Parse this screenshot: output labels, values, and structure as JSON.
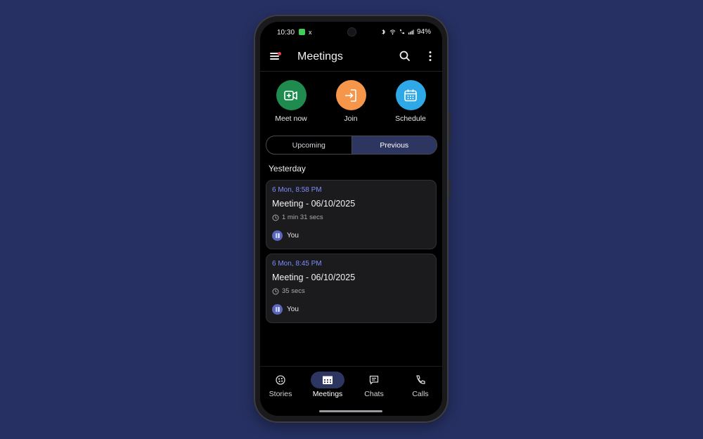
{
  "status_bar": {
    "time": "10:30",
    "x_icon": "x",
    "battery": "94%",
    "icons": [
      "bluetooth-icon",
      "wifi-icon",
      "call-icon",
      "signal-icon"
    ]
  },
  "app_bar": {
    "title": "Meetings",
    "icons": [
      "menu-icon",
      "search-icon",
      "more-vertical-icon"
    ]
  },
  "quick_actions": [
    {
      "label": "Meet now",
      "icon": "video-plus-icon",
      "color": "#1f8b4e"
    },
    {
      "label": "Join",
      "icon": "join-icon",
      "color": "#f5964a"
    },
    {
      "label": "Schedule",
      "icon": "calendar-icon",
      "color": "#2ea8e6"
    }
  ],
  "tabs": [
    {
      "label": "Upcoming",
      "active": false
    },
    {
      "label": "Previous",
      "active": true
    }
  ],
  "section_label": "Yesterday",
  "meetings": [
    {
      "when": "6 Mon, 8:58 PM",
      "title": "Meeting - 06/10/2025",
      "duration": "1 min 31 secs",
      "attendee": "You"
    },
    {
      "when": "6 Mon, 8:45 PM",
      "title": "Meeting - 06/10/2025",
      "duration": "35 secs",
      "attendee": "You"
    }
  ],
  "bottom_nav": [
    {
      "label": "Stories",
      "icon": "stories-icon",
      "active": false
    },
    {
      "label": "Meetings",
      "icon": "meetings-icon",
      "active": true
    },
    {
      "label": "Chats",
      "icon": "chat-icon",
      "active": false
    },
    {
      "label": "Calls",
      "icon": "phone-icon",
      "active": false
    }
  ],
  "colors": {
    "background": "#263062",
    "accent": "#2d3561",
    "link": "#7d8cff"
  }
}
